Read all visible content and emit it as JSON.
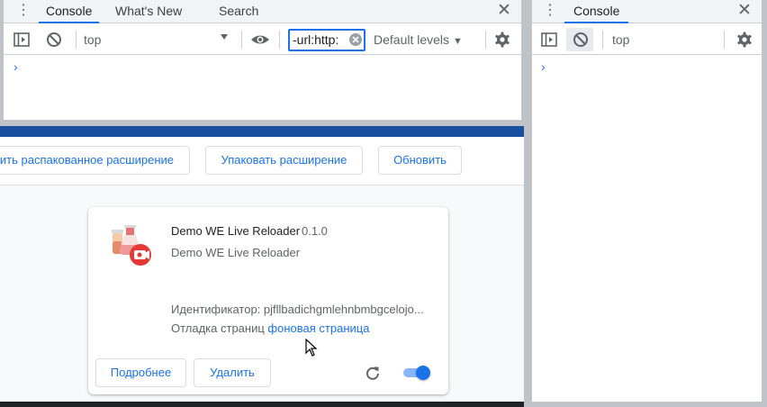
{
  "extensions_page": {
    "toolbar": {
      "load_unpacked_label": "ить распакованное расширение",
      "pack_label": "Упаковать расширение",
      "update_label": "Обновить"
    },
    "card": {
      "name": "Demo WE Live Reloader",
      "version": "0.1.0",
      "description": "Demo WE Live Reloader",
      "id_label": "Идентификатор: pjfllbadichgmlehnbmbgcelojo...",
      "inspect_label": "Отладка страниц",
      "inspect_link": "фоновая страница",
      "details_button": "Подробнее",
      "remove_button": "Удалить",
      "enabled": true
    }
  },
  "devtools_left": {
    "tabs": [
      "Console",
      "What's New",
      "Search"
    ],
    "active_tab": "Console",
    "context": "top",
    "filter_value": "-url:http:",
    "levels": "Default levels",
    "prompt": "›"
  },
  "devtools_right": {
    "tabs": [
      "Console"
    ],
    "active_tab": "Console",
    "context": "top",
    "prompt": "›"
  },
  "colors": {
    "accent": "#1a73e8",
    "banner": "#1a4fa0",
    "toggle_track": "#8ab4f8"
  }
}
